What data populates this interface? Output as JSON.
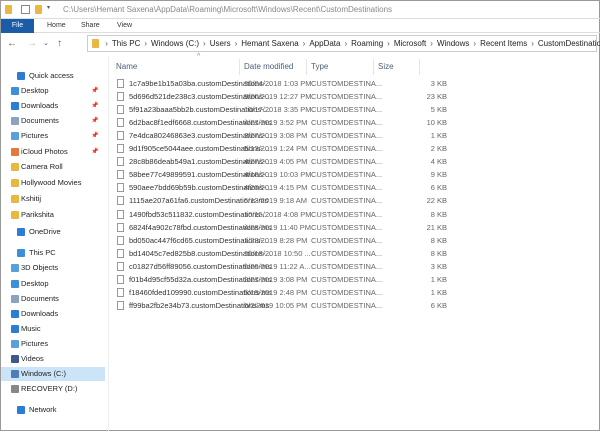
{
  "window": {
    "title_path": "C:\\Users\\Hemant Saxena\\AppData\\Roaming\\Microsoft\\Windows\\Recent\\CustomDestinations"
  },
  "ribbon": {
    "tabs": [
      "File",
      "Home",
      "Share",
      "View"
    ]
  },
  "breadcrumb": [
    "This PC",
    "Windows (C:)",
    "Users",
    "Hemant Saxena",
    "AppData",
    "Roaming",
    "Microsoft",
    "Windows",
    "Recent Items",
    "CustomDestinations"
  ],
  "columns": {
    "name": "Name",
    "date": "Date modified",
    "type": "Type",
    "size": "Size"
  },
  "sidebar": [
    {
      "label": "Quick access",
      "icon": "star",
      "color": "#2b7cd3"
    },
    {
      "label": "Desktop",
      "icon": "desktop",
      "color": "#3d8fd8",
      "pinned": true
    },
    {
      "label": "Downloads",
      "icon": "download",
      "color": "#2a7fd4",
      "pinned": true
    },
    {
      "label": "Documents",
      "icon": "document",
      "color": "#8aa4c0",
      "pinned": true
    },
    {
      "label": "Pictures",
      "icon": "pictures",
      "color": "#5aa0d8",
      "pinned": true
    },
    {
      "label": "iCloud Photos",
      "icon": "icloud",
      "color": "#e07a3a",
      "pinned": true
    },
    {
      "label": "Camera Roll",
      "icon": "folder",
      "color": "#e9b840"
    },
    {
      "label": "Hollywood Movies",
      "icon": "folder",
      "color": "#e9b840"
    },
    {
      "label": "Kshitij",
      "icon": "folder",
      "color": "#e9b840"
    },
    {
      "label": "Parikshita",
      "icon": "folder",
      "color": "#e9b840"
    },
    {
      "label": "OneDrive",
      "icon": "cloud",
      "color": "#2b7cd3"
    },
    {
      "label": "This PC",
      "icon": "computer",
      "color": "#3d8fd8"
    },
    {
      "label": "3D Objects",
      "icon": "cube",
      "color": "#5aa0d8"
    },
    {
      "label": "Desktop",
      "icon": "desktop",
      "color": "#3d8fd8"
    },
    {
      "label": "Documents",
      "icon": "document",
      "color": "#8aa4c0"
    },
    {
      "label": "Downloads",
      "icon": "download",
      "color": "#2a7fd4"
    },
    {
      "label": "Music",
      "icon": "music",
      "color": "#2a7fd4"
    },
    {
      "label": "Pictures",
      "icon": "pictures",
      "color": "#5aa0d8"
    },
    {
      "label": "Videos",
      "icon": "video",
      "color": "#3d5a8a"
    },
    {
      "label": "Windows (C:)",
      "icon": "drive",
      "color": "#4a7fb8",
      "selected": true
    },
    {
      "label": "RECOVERY (D:)",
      "icon": "drive",
      "color": "#888888"
    },
    {
      "label": "Network",
      "icon": "network",
      "color": "#2b7cd3"
    }
  ],
  "files": [
    {
      "name": "1c7a9be1b15a03ba.customDestinations-...",
      "date": "10/24/2018 1:03 PM",
      "type": "CUSTOMDESTINA...",
      "size": "3 KB"
    },
    {
      "name": "5d696d521de238c3.customDestinations-...",
      "date": "5/20/2019 12:27 PM",
      "type": "CUSTOMDESTINA...",
      "size": "23 KB"
    },
    {
      "name": "5f91a23baaa5bb2b.customDestinations-...",
      "date": "10/17/2018 3:35 PM",
      "type": "CUSTOMDESTINA...",
      "size": "5 KB"
    },
    {
      "name": "6d2bac8f1edf6668.customDestinations-ms",
      "date": "4/27/2019 3:52 PM",
      "type": "CUSTOMDESTINA...",
      "size": "10 KB"
    },
    {
      "name": "7e4dca80246863e3.customDestinations-...",
      "date": "2/27/2019 3:08 PM",
      "type": "CUSTOMDESTINA...",
      "size": "1 KB"
    },
    {
      "name": "9d1f905ce5044aee.customDestinations-...",
      "date": "5/13/2019 1:24 PM",
      "type": "CUSTOMDESTINA...",
      "size": "2 KB"
    },
    {
      "name": "28c8b86deab549a1.customDestinations-...",
      "date": "4/27/2019 4:05 PM",
      "type": "CUSTOMDESTINA...",
      "size": "4 KB"
    },
    {
      "name": "58bee77c49899591.customDestinations-...",
      "date": "4/18/2019 10:03 PM",
      "type": "CUSTOMDESTINA...",
      "size": "9 KB"
    },
    {
      "name": "590aee7bdd69b59b.customDestinations-...",
      "date": "4/20/2019 4:15 PM",
      "type": "CUSTOMDESTINA...",
      "size": "6 KB"
    },
    {
      "name": "1115ae207a61fa6.customDestinations-ms",
      "date": "5/13/2019 9:18 AM",
      "type": "CUSTOMDESTINA...",
      "size": "22 KB"
    },
    {
      "name": "1490fbd53c511832.customDestinations-...",
      "date": "10/15/2018 4:08 PM",
      "type": "CUSTOMDESTINA...",
      "size": "8 KB"
    },
    {
      "name": "6824f4a902c78fbd.customDestinations-ms",
      "date": "4/28/2019 11:40 PM",
      "type": "CUSTOMDESTINA...",
      "size": "21 KB"
    },
    {
      "name": "bd050ac447f6cd65.customDestinations-...",
      "date": "1/23/2019 8:28 PM",
      "type": "CUSTOMDESTINA...",
      "size": "8 KB"
    },
    {
      "name": "bd14045c7ed825b8.customDestinations-...",
      "date": "10/18/2018 10:50 ...",
      "type": "CUSTOMDESTINA...",
      "size": "8 KB"
    },
    {
      "name": "c01827d56ff89056.customDestinations-ms",
      "date": "5/20/2019 11:22 A...",
      "type": "CUSTOMDESTINA...",
      "size": "3 KB"
    },
    {
      "name": "f01b4d95cf55d32a.customDestinations-ms",
      "date": "2/27/2019 3:08 PM",
      "type": "CUSTOMDESTINA...",
      "size": "1 KB"
    },
    {
      "name": "f18460fded109990.customDestinations-ms",
      "date": "5/19/2019 2:48 PM",
      "type": "CUSTOMDESTINA...",
      "size": "1 KB"
    },
    {
      "name": "ff99ba2fb2e34b73.customDestinations-ms",
      "date": "5/2/2019 10:05 PM",
      "type": "CUSTOMDESTINA...",
      "size": "6 KB"
    }
  ]
}
